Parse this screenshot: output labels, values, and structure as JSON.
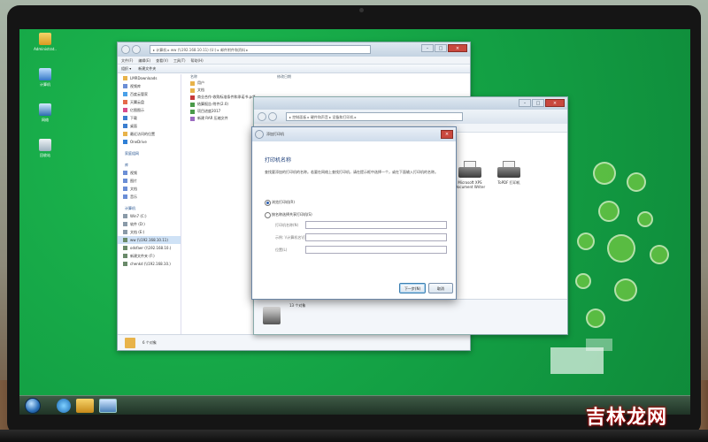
{
  "desktop": {
    "icons": [
      {
        "label": "Administrat..",
        "name": "user-folder-icon"
      },
      {
        "label": "计算机",
        "name": "computer-icon"
      },
      {
        "label": "网络",
        "name": "network-icon"
      },
      {
        "label": "回收站",
        "name": "recycle-bin-icon"
      }
    ]
  },
  "explorer": {
    "address": "▸ 计算机 ▸ ww (\\\\192.168.10.11) (U:) ▸ 邮件附件和资料 ▸",
    "menus": [
      "文件(F)",
      "编辑(E)",
      "查看(V)",
      "工具(T)",
      "帮助(H)"
    ],
    "toolbar": [
      "组织 ▾",
      "新建文件夹"
    ],
    "nav_favorites": [
      "收藏夹",
      "下载",
      "桌面",
      "最近访问的位置"
    ],
    "nav_items": [
      "LMRDownloads",
      "视频库",
      "百度云管家",
      "天翼云盘",
      "亿图图示",
      "下载",
      "桌面",
      "最近访问的位置",
      "OneDrive"
    ],
    "nav_groups": [
      "库",
      "视频",
      "图片",
      "文档",
      "音乐",
      "计算机",
      "Win7 (C:)",
      "软件 (D:)",
      "文档 (E:)",
      "ww (\\\\192.168.10.11)",
      "odsfaer (\\\\192.168.10.)",
      "新建文件夹 (F:)",
      "chenkd (\\\\192.168.10.)"
    ],
    "nav_group_labels": {
      "network": "家庭组网"
    },
    "col_header": "名称",
    "col_date": "修改日期",
    "files": [
      "用户",
      "文档",
      "商业合作-收购标准条件和承诺书.pdf",
      "结算报告-附件(2.0)",
      "项目进度2017",
      "新建 RAR 压缩文件"
    ],
    "status": "6 个对象"
  },
  "devices": {
    "address": "▸ 控制面板 ▸ 硬件和声音 ▸ 设备和打印机 ▸",
    "printers": [
      {
        "label": "Microsoft XPS Document Writer"
      },
      {
        "label": "ToPDF 打印机"
      }
    ],
    "status": "13 个对象"
  },
  "dialog": {
    "title": "添加打印机",
    "heading": "打印机名称",
    "description": "查找要添加的打印机的名称。若要在网络上查找打印机，请在提示框中选择一个，或在下面输入打印机的名称。",
    "radio_browse": "浏览打印机(R)",
    "radio_named": "按名称选择共享打印机(S)",
    "field_1_label": "打印机名称(N)",
    "field_2_label": "示例: \\\\计算机名\\打印机名",
    "field_3_label": "位置(L)",
    "next_button": "下一步(N)",
    "cancel_button": "取消"
  },
  "watermark": "吉林龙网"
}
